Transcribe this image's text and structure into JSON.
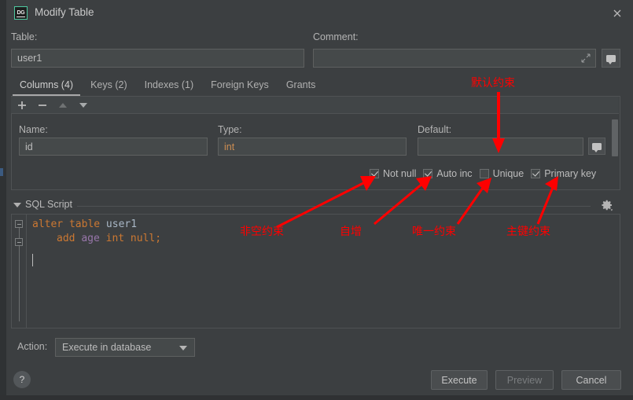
{
  "window": {
    "title": "Modify Table",
    "logo_text": "DG",
    "close_icon": "close-icon"
  },
  "header": {
    "table_label": "Table:",
    "table_value": "user1",
    "comment_label": "Comment:",
    "comment_value": "",
    "comment_expand_icon": "expand-icon",
    "comment_button_icon": "comment-bubble-icon"
  },
  "tabs": [
    {
      "label": "Columns (4)",
      "active": true
    },
    {
      "label": "Keys (2)",
      "active": false
    },
    {
      "label": "Indexes (1)",
      "active": false
    },
    {
      "label": "Foreign Keys",
      "active": false
    },
    {
      "label": "Grants",
      "active": false
    }
  ],
  "toolbar": {
    "add_icon": "plus-icon",
    "remove_icon": "minus-icon",
    "move_up_icon": "arrow-up-icon",
    "move_down_icon": "arrow-down-icon"
  },
  "column_editor": {
    "name_label": "Name:",
    "name_value": "id",
    "type_label": "Type:",
    "type_value": "int",
    "default_label": "Default:",
    "default_value": "",
    "default_button_icon": "comment-bubble-icon",
    "checkboxes": [
      {
        "label": "Not null",
        "checked": true
      },
      {
        "label": "Auto inc",
        "checked": true
      },
      {
        "label": "Unique",
        "checked": false
      },
      {
        "label": "Primary key",
        "checked": true
      }
    ]
  },
  "sql_script": {
    "section_title": "SQL Script",
    "collapse_icon": "triangle-down-icon",
    "settings_icon": "gear-icon",
    "line1": {
      "kw1": "alter table ",
      "ident": "user1"
    },
    "line2": {
      "kw_add": "add ",
      "column": "age",
      "kw_type": " int null;"
    },
    "full_text": "alter table user1\n    add age int null;"
  },
  "footer": {
    "action_label": "Action:",
    "action_value": "Execute in database",
    "help_icon": "question-mark-icon",
    "buttons": [
      {
        "label": "Execute",
        "enabled": true
      },
      {
        "label": "Preview",
        "enabled": false
      },
      {
        "label": "Cancel",
        "enabled": true
      }
    ]
  },
  "annotations": {
    "color": "#ff0000",
    "items": [
      {
        "text": "默认约束",
        "meaning": "default-constraint"
      },
      {
        "text": "非空约束",
        "meaning": "not-null-constraint"
      },
      {
        "text": "自增",
        "meaning": "auto-increment"
      },
      {
        "text": "唯一约束",
        "meaning": "unique-constraint"
      },
      {
        "text": "主键约束",
        "meaning": "primary-key-constraint"
      }
    ]
  }
}
